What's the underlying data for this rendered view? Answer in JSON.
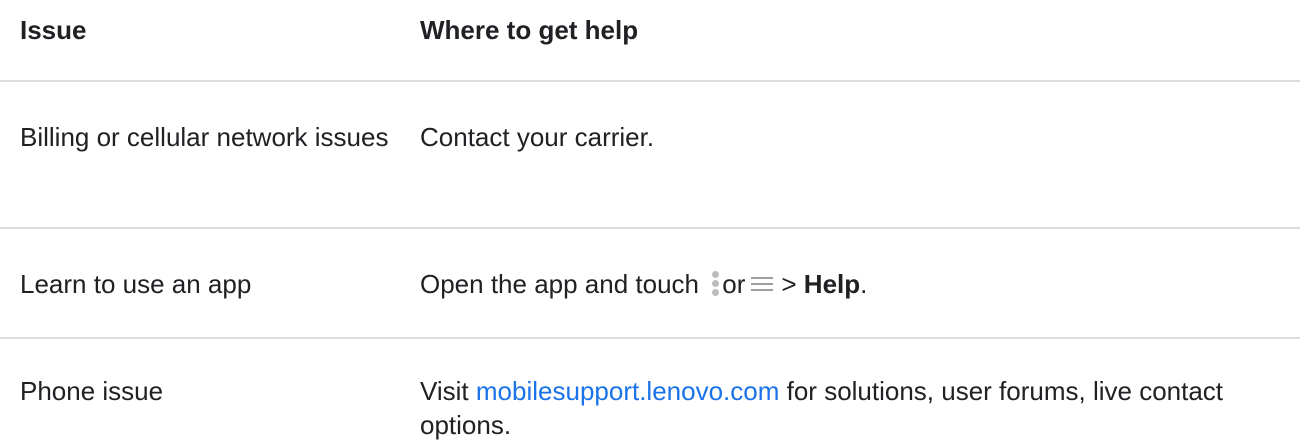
{
  "header": {
    "issue": "Issue",
    "help": "Where to get help"
  },
  "rows": [
    {
      "issue": "Billing or cellular network issues",
      "help": "Contact your carrier."
    },
    {
      "issue": "Learn to use an app",
      "help_prefix": "Open the app and touch",
      "icon_more": "more-vertical-icon",
      "help_or": "or",
      "icon_menu": "menu-icon",
      "help_sep": ">",
      "help_bold": "Help",
      "help_suffix": "."
    },
    {
      "issue": "Phone issue",
      "help_prefix": "Visit",
      "help_link": "mobilesupport.lenovo.com",
      "help_suffix": "for solutions, user forums, live contact options."
    }
  ],
  "colors": {
    "link": "#1a73e8",
    "divider": "#dadce0",
    "text": "#202124"
  }
}
